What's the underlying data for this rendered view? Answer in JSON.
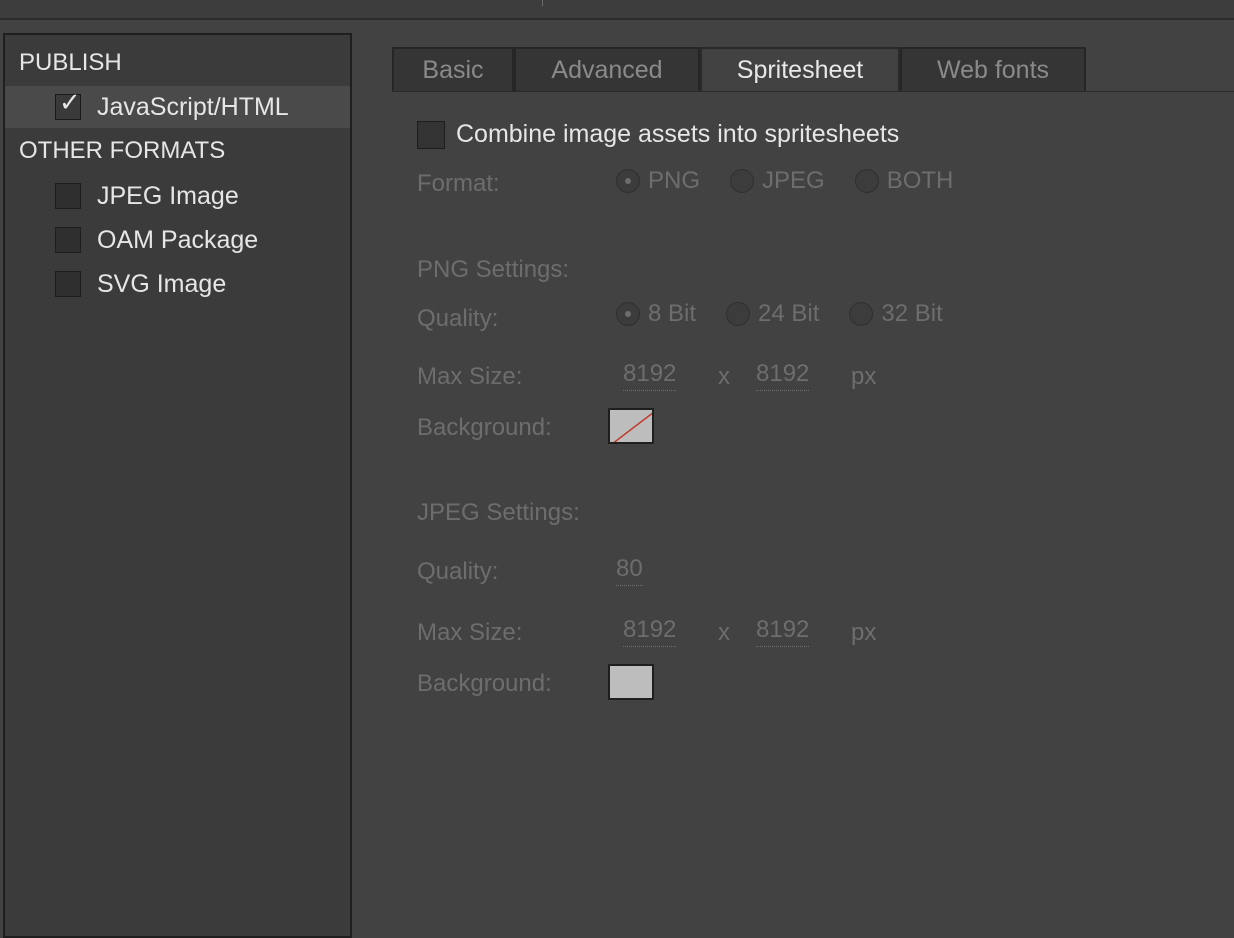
{
  "sidebar": {
    "publish_heading": "PUBLISH",
    "publish_items": [
      {
        "label": "JavaScript/HTML",
        "checked": true
      }
    ],
    "other_heading": "OTHER FORMATS",
    "other_items": [
      {
        "label": "JPEG Image",
        "checked": false
      },
      {
        "label": "OAM Package",
        "checked": false
      },
      {
        "label": "SVG Image",
        "checked": false
      }
    ]
  },
  "tabs": [
    {
      "label": "Basic",
      "active": false
    },
    {
      "label": "Advanced",
      "active": false
    },
    {
      "label": "Spritesheet",
      "active": true
    },
    {
      "label": "Web fonts",
      "active": false
    }
  ],
  "spritesheet": {
    "combine_label": "Combine image assets into spritesheets",
    "combine_checked": false,
    "format_label": "Format:",
    "format_options": [
      "PNG",
      "JPEG",
      "BOTH"
    ],
    "format_selected": "PNG",
    "png": {
      "heading": "PNG Settings:",
      "quality_label": "Quality:",
      "quality_options": [
        "8 Bit",
        "24 Bit",
        "32 Bit"
      ],
      "quality_selected": "8 Bit",
      "max_size_label": "Max Size:",
      "max_width": "8192",
      "times": "x",
      "max_height": "8192",
      "unit": "px",
      "background_label": "Background:",
      "background": "transparent"
    },
    "jpeg": {
      "heading": "JPEG Settings:",
      "quality_label": "Quality:",
      "quality_value": "80",
      "max_size_label": "Max Size:",
      "max_width": "8192",
      "times": "x",
      "max_height": "8192",
      "unit": "px",
      "background_label": "Background:",
      "background_color": "#bdbdbd"
    }
  },
  "colors": {
    "panel_bg": "#424242",
    "sidebar_bg": "#3b3b3b",
    "text_active": "#e6e6e6",
    "text_disabled": "#6d6d6d",
    "transparent_slash": "#c0392b"
  }
}
